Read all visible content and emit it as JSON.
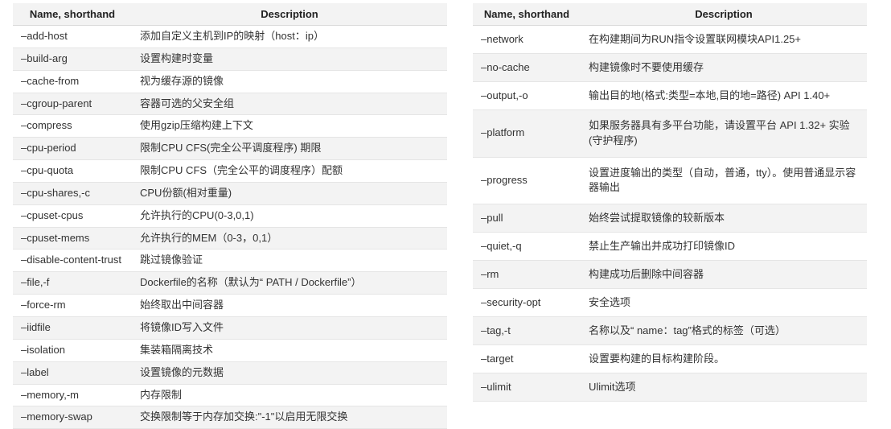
{
  "header_name": "Name, shorthand",
  "header_desc": "Description",
  "left": [
    {
      "name": "–add-host",
      "desc": "添加自定义主机到IP的映射（host：ip）"
    },
    {
      "name": "–build-arg",
      "desc": "设置构建时变量"
    },
    {
      "name": "–cache-from",
      "desc": "视为缓存源的镜像"
    },
    {
      "name": "–cgroup-parent",
      "desc": "容器可选的父安全组"
    },
    {
      "name": "–compress",
      "desc": "使用gzip压缩构建上下文"
    },
    {
      "name": "–cpu-period",
      "desc": "限制CPU CFS(完全公平调度程序) 期限"
    },
    {
      "name": "–cpu-quota",
      "desc": "限制CPU CFS（完全公平的调度程序）配额"
    },
    {
      "name": "–cpu-shares,-c",
      "desc": "CPU份额(相对重量)"
    },
    {
      "name": "–cpuset-cpus",
      "desc": "允许执行的CPU(0-3,0,1)"
    },
    {
      "name": "–cpuset-mems",
      "desc": "允许执行的MEM（0-3，0,1）"
    },
    {
      "name": "–disable-content-trust",
      "desc": "跳过镜像验证"
    },
    {
      "name": "–file,-f",
      "desc": "Dockerfile的名称（默认为“ PATH / Dockerfile”）"
    },
    {
      "name": "–force-rm",
      "desc": "始终取出中间容器"
    },
    {
      "name": "–iidfile",
      "desc": "将镜像ID写入文件"
    },
    {
      "name": "–isolation",
      "desc": "集装箱隔离技术"
    },
    {
      "name": "–label",
      "desc": "设置镜像的元数据"
    },
    {
      "name": "–memory,-m",
      "desc": "内存限制"
    },
    {
      "name": "–memory-swap",
      "desc": "交换限制等于内存加交换:\"-1\"以启用无限交换"
    }
  ],
  "right": [
    {
      "name": "–network",
      "desc": "在构建期间为RUN指令设置联网模块API1.25+"
    },
    {
      "name": "–no-cache",
      "desc": "构建镜像时不要使用缓存"
    },
    {
      "name": "–output,-o",
      "desc": "输出目的地(格式:类型=本地,目的地=路径) API 1.40+"
    },
    {
      "name": "–platform",
      "desc": "如果服务器具有多平台功能，请设置平台 API 1.32+ 实验(守护程序)"
    },
    {
      "name": "–progress",
      "desc": "设置进度输出的类型（自动，普通，tty）。使用普通显示容器输出"
    },
    {
      "name": "–pull",
      "desc": "始终尝试提取镜像的较新版本"
    },
    {
      "name": "–quiet,-q",
      "desc": "禁止生产输出并成功打印镜像ID"
    },
    {
      "name": "–rm",
      "desc": "构建成功后删除中间容器"
    },
    {
      "name": "–security-opt",
      "desc": "安全选项"
    },
    {
      "name": "–tag,-t",
      "desc": "名称以及“ name：tag”格式的标签（可选）"
    },
    {
      "name": "–target",
      "desc": "设置要构建的目标构建阶段。"
    },
    {
      "name": "–ulimit",
      "desc": "Ulimit选项"
    }
  ]
}
